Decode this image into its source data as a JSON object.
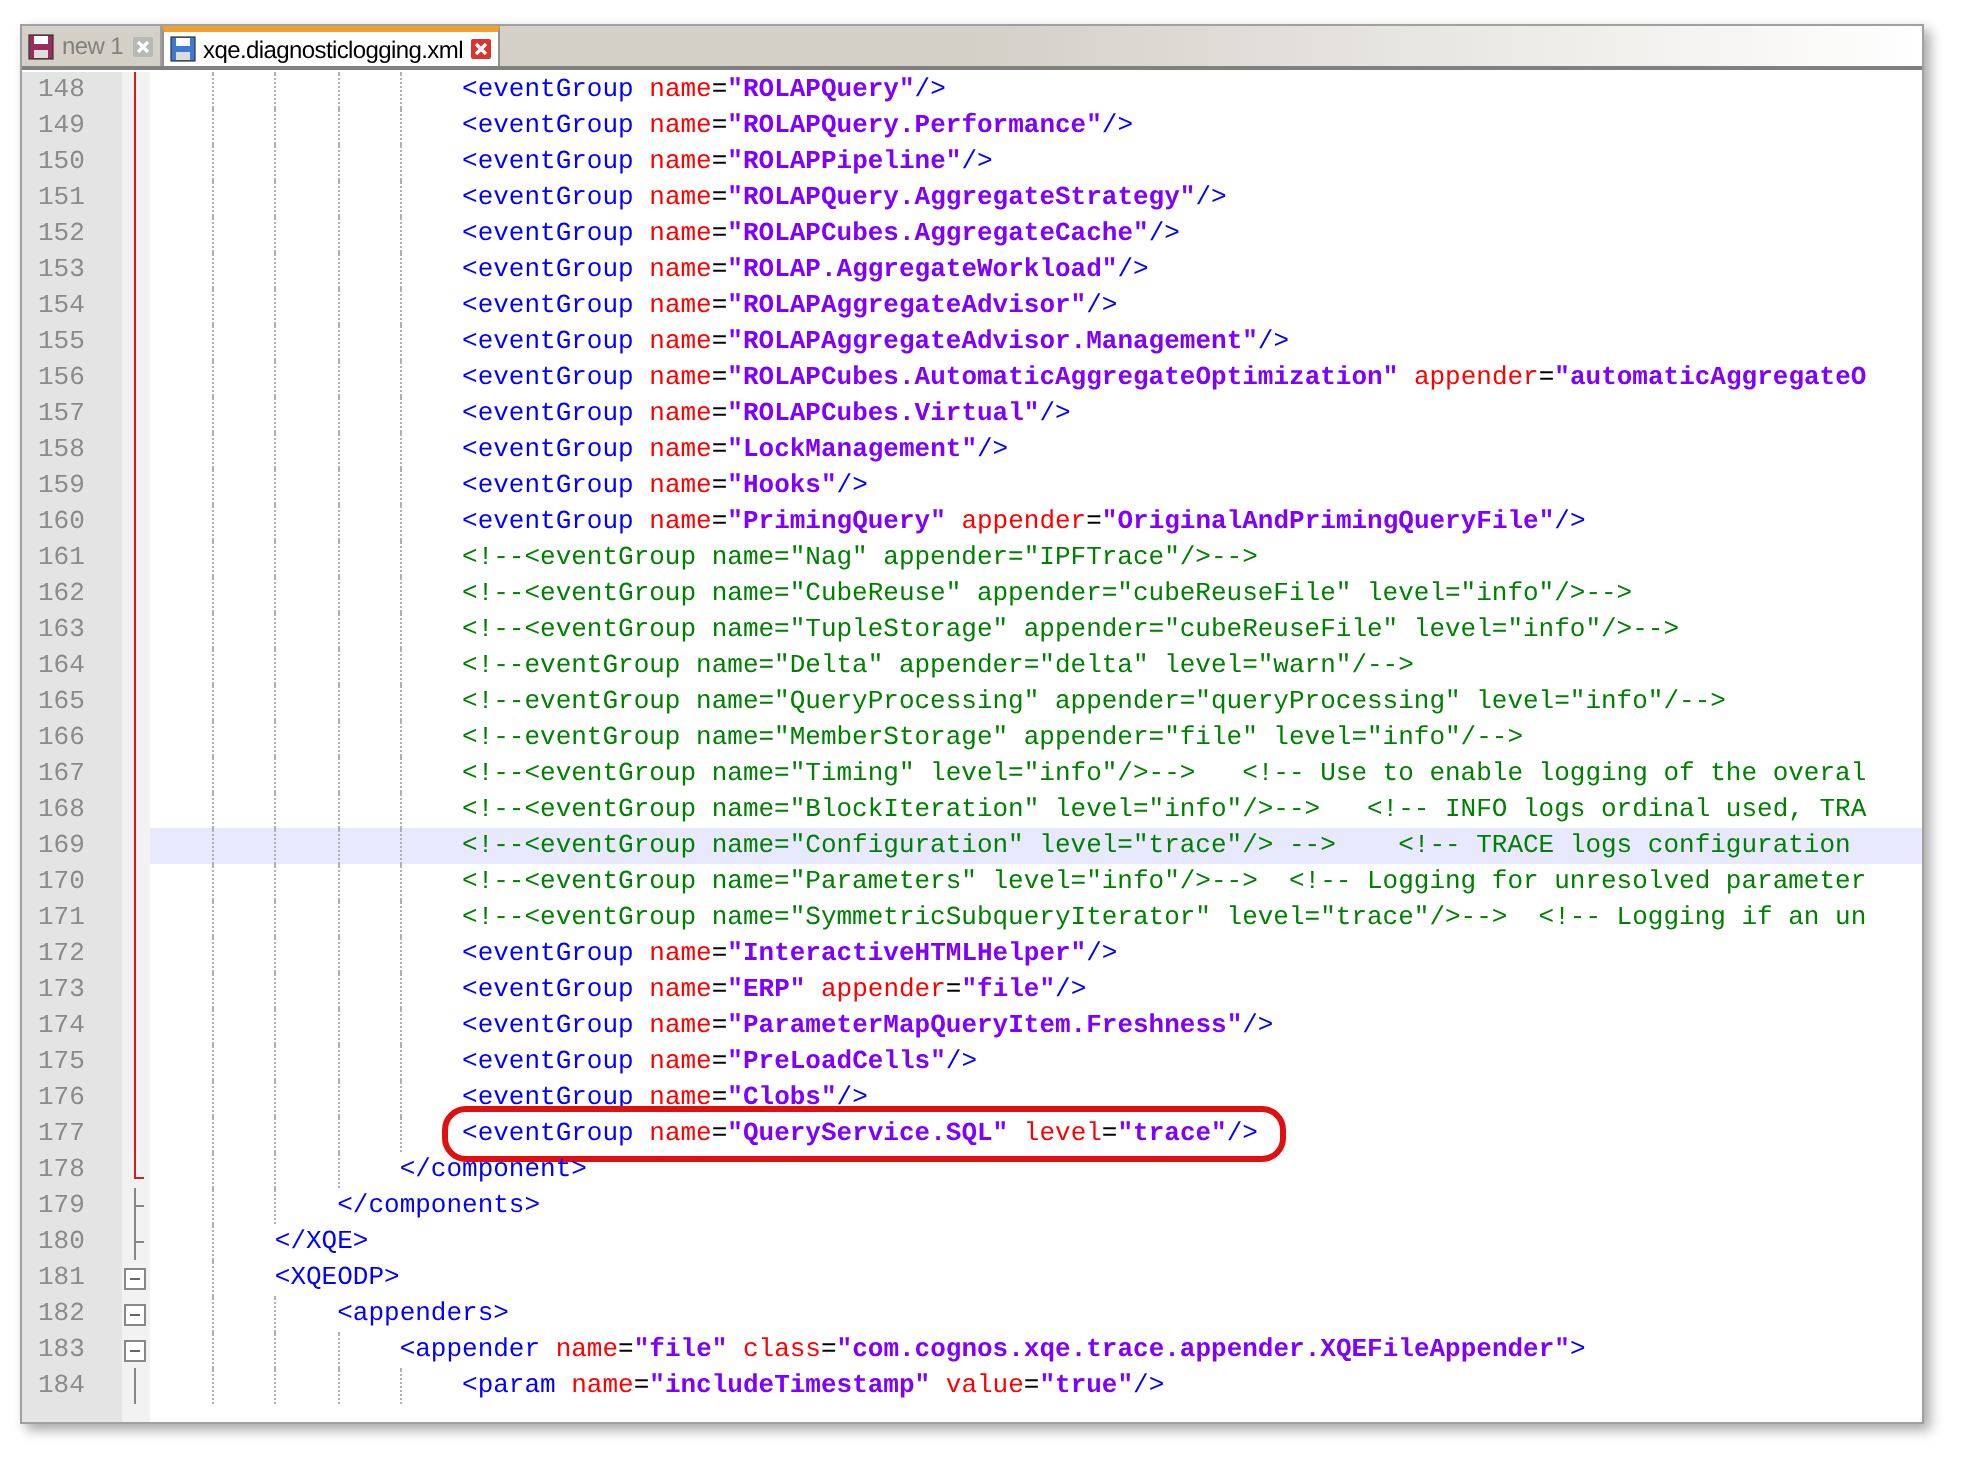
{
  "tabs": [
    {
      "label": "new 1",
      "selected": false,
      "modified": true
    },
    {
      "label": "xqe.diagnosticlogging.xml",
      "selected": true,
      "modified": false
    }
  ],
  "lines": [
    {
      "number": "148",
      "kind": "red",
      "current": false,
      "circled": false,
      "segments": [
        {
          "kind": "tag",
          "text": "                    <eventGroup"
        },
        {
          "kind": "attr",
          "text": " name"
        },
        {
          "kind": "eq",
          "text": "="
        },
        {
          "kind": "value",
          "text": "\"ROLAPQuery\""
        },
        {
          "kind": "tag",
          "text": "/>"
        }
      ]
    },
    {
      "number": "149",
      "kind": "red",
      "current": false,
      "circled": false,
      "segments": [
        {
          "kind": "tag",
          "text": "                    <eventGroup"
        },
        {
          "kind": "attr",
          "text": " name"
        },
        {
          "kind": "eq",
          "text": "="
        },
        {
          "kind": "value",
          "text": "\"ROLAPQuery.Performance\""
        },
        {
          "kind": "tag",
          "text": "/>"
        }
      ]
    },
    {
      "number": "150",
      "kind": "red",
      "current": false,
      "circled": false,
      "segments": [
        {
          "kind": "tag",
          "text": "                    <eventGroup"
        },
        {
          "kind": "attr",
          "text": " name"
        },
        {
          "kind": "eq",
          "text": "="
        },
        {
          "kind": "value",
          "text": "\"ROLAPPipeline\""
        },
        {
          "kind": "tag",
          "text": "/>"
        }
      ]
    },
    {
      "number": "151",
      "kind": "red",
      "current": false,
      "circled": false,
      "segments": [
        {
          "kind": "tag",
          "text": "                    <eventGroup"
        },
        {
          "kind": "attr",
          "text": " name"
        },
        {
          "kind": "eq",
          "text": "="
        },
        {
          "kind": "value",
          "text": "\"ROLAPQuery.AggregateStrategy\""
        },
        {
          "kind": "tag",
          "text": "/>"
        }
      ]
    },
    {
      "number": "152",
      "kind": "red",
      "current": false,
      "circled": false,
      "segments": [
        {
          "kind": "tag",
          "text": "                    <eventGroup"
        },
        {
          "kind": "attr",
          "text": " name"
        },
        {
          "kind": "eq",
          "text": "="
        },
        {
          "kind": "value",
          "text": "\"ROLAPCubes.AggregateCache\""
        },
        {
          "kind": "tag",
          "text": "/>"
        }
      ]
    },
    {
      "number": "153",
      "kind": "red",
      "current": false,
      "circled": false,
      "segments": [
        {
          "kind": "tag",
          "text": "                    <eventGroup"
        },
        {
          "kind": "attr",
          "text": " name"
        },
        {
          "kind": "eq",
          "text": "="
        },
        {
          "kind": "value",
          "text": "\"ROLAP.AggregateWorkload\""
        },
        {
          "kind": "tag",
          "text": "/>"
        }
      ]
    },
    {
      "number": "154",
      "kind": "red",
      "current": false,
      "circled": false,
      "segments": [
        {
          "kind": "tag",
          "text": "                    <eventGroup"
        },
        {
          "kind": "attr",
          "text": " name"
        },
        {
          "kind": "eq",
          "text": "="
        },
        {
          "kind": "value",
          "text": "\"ROLAPAggregateAdvisor\""
        },
        {
          "kind": "tag",
          "text": "/>"
        }
      ]
    },
    {
      "number": "155",
      "kind": "red",
      "current": false,
      "circled": false,
      "segments": [
        {
          "kind": "tag",
          "text": "                    <eventGroup"
        },
        {
          "kind": "attr",
          "text": " name"
        },
        {
          "kind": "eq",
          "text": "="
        },
        {
          "kind": "value",
          "text": "\"ROLAPAggregateAdvisor.Management\""
        },
        {
          "kind": "tag",
          "text": "/>"
        }
      ]
    },
    {
      "number": "156",
      "kind": "red",
      "current": false,
      "circled": false,
      "segments": [
        {
          "kind": "tag",
          "text": "                    <eventGroup"
        },
        {
          "kind": "attr",
          "text": " name"
        },
        {
          "kind": "eq",
          "text": "="
        },
        {
          "kind": "value",
          "text": "\"ROLAPCubes.AutomaticAggregateOptimization\""
        },
        {
          "kind": "attr",
          "text": " appender"
        },
        {
          "kind": "eq",
          "text": "="
        },
        {
          "kind": "value",
          "text": "\"automaticAggregateO"
        }
      ]
    },
    {
      "number": "157",
      "kind": "red",
      "current": false,
      "circled": false,
      "segments": [
        {
          "kind": "tag",
          "text": "                    <eventGroup"
        },
        {
          "kind": "attr",
          "text": " name"
        },
        {
          "kind": "eq",
          "text": "="
        },
        {
          "kind": "value",
          "text": "\"ROLAPCubes.Virtual\""
        },
        {
          "kind": "tag",
          "text": "/>"
        }
      ]
    },
    {
      "number": "158",
      "kind": "red",
      "current": false,
      "circled": false,
      "segments": [
        {
          "kind": "tag",
          "text": "                    <eventGroup"
        },
        {
          "kind": "attr",
          "text": " name"
        },
        {
          "kind": "eq",
          "text": "="
        },
        {
          "kind": "value",
          "text": "\"LockManagement\""
        },
        {
          "kind": "tag",
          "text": "/>"
        }
      ]
    },
    {
      "number": "159",
      "kind": "red",
      "current": false,
      "circled": false,
      "segments": [
        {
          "kind": "tag",
          "text": "                    <eventGroup"
        },
        {
          "kind": "attr",
          "text": " name"
        },
        {
          "kind": "eq",
          "text": "="
        },
        {
          "kind": "value",
          "text": "\"Hooks\""
        },
        {
          "kind": "tag",
          "text": "/>"
        }
      ]
    },
    {
      "number": "160",
      "kind": "red",
      "current": false,
      "circled": false,
      "segments": [
        {
          "kind": "tag",
          "text": "                    <eventGroup"
        },
        {
          "kind": "attr",
          "text": " name"
        },
        {
          "kind": "eq",
          "text": "="
        },
        {
          "kind": "value",
          "text": "\"PrimingQuery\""
        },
        {
          "kind": "attr",
          "text": " appender"
        },
        {
          "kind": "eq",
          "text": "="
        },
        {
          "kind": "value",
          "text": "\"OriginalAndPrimingQueryFile\""
        },
        {
          "kind": "tag",
          "text": "/>"
        }
      ]
    },
    {
      "number": "161",
      "kind": "red",
      "current": false,
      "circled": false,
      "segments": [
        {
          "kind": "comment",
          "text": "                    <!--<eventGroup name=\"Nag\" appender=\"IPFTrace\"/>-->"
        }
      ]
    },
    {
      "number": "162",
      "kind": "red",
      "current": false,
      "circled": false,
      "segments": [
        {
          "kind": "comment",
          "text": "                    <!--<eventGroup name=\"CubeReuse\" appender=\"cubeReuseFile\" level=\"info\"/>-->"
        }
      ]
    },
    {
      "number": "163",
      "kind": "red",
      "current": false,
      "circled": false,
      "segments": [
        {
          "kind": "comment",
          "text": "                    <!--<eventGroup name=\"TupleStorage\" appender=\"cubeReuseFile\" level=\"info\"/>-->"
        }
      ]
    },
    {
      "number": "164",
      "kind": "red",
      "current": false,
      "circled": false,
      "segments": [
        {
          "kind": "comment",
          "text": "                    <!--eventGroup name=\"Delta\" appender=\"delta\" level=\"warn\"/-->"
        }
      ]
    },
    {
      "number": "165",
      "kind": "red",
      "current": false,
      "circled": false,
      "segments": [
        {
          "kind": "comment",
          "text": "                    <!--eventGroup name=\"QueryProcessing\" appender=\"queryProcessing\" level=\"info\"/-->"
        }
      ]
    },
    {
      "number": "166",
      "kind": "red",
      "current": false,
      "circled": false,
      "segments": [
        {
          "kind": "comment",
          "text": "                    <!--eventGroup name=\"MemberStorage\" appender=\"file\" level=\"info\"/-->"
        }
      ]
    },
    {
      "number": "167",
      "kind": "red",
      "current": false,
      "circled": false,
      "segments": [
        {
          "kind": "comment",
          "text": "                    <!--<eventGroup name=\"Timing\" level=\"info\"/>-->   <!-- Use to enable logging of the overal"
        }
      ]
    },
    {
      "number": "168",
      "kind": "red",
      "current": false,
      "circled": false,
      "segments": [
        {
          "kind": "comment",
          "text": "                    <!--<eventGroup name=\"BlockIteration\" level=\"info\"/>-->   <!-- INFO logs ordinal used, TRA"
        }
      ]
    },
    {
      "number": "169",
      "kind": "red",
      "current": true,
      "circled": false,
      "segments": [
        {
          "kind": "comment",
          "text": "                    <!--<eventGroup name=\"Configuration\" level=\"trace\"/> -->    <!-- TRACE logs configuration"
        }
      ]
    },
    {
      "number": "170",
      "kind": "red",
      "current": false,
      "circled": false,
      "segments": [
        {
          "kind": "comment",
          "text": "                    <!--<eventGroup name=\"Parameters\" level=\"info\"/>-->  <!-- Logging for unresolved parameter"
        }
      ]
    },
    {
      "number": "171",
      "kind": "red",
      "current": false,
      "circled": false,
      "segments": [
        {
          "kind": "comment",
          "text": "                    <!--<eventGroup name=\"SymmetricSubqueryIterator\" level=\"trace\"/>-->  <!-- Logging if an un"
        }
      ]
    },
    {
      "number": "172",
      "kind": "red",
      "current": false,
      "circled": false,
      "segments": [
        {
          "kind": "tag",
          "text": "                    <eventGroup"
        },
        {
          "kind": "attr",
          "text": " name"
        },
        {
          "kind": "eq",
          "text": "="
        },
        {
          "kind": "value",
          "text": "\"InteractiveHTMLHelper\""
        },
        {
          "kind": "tag",
          "text": "/>"
        }
      ]
    },
    {
      "number": "173",
      "kind": "red",
      "current": false,
      "circled": false,
      "segments": [
        {
          "kind": "tag",
          "text": "                    <eventGroup"
        },
        {
          "kind": "attr",
          "text": " name"
        },
        {
          "kind": "eq",
          "text": "="
        },
        {
          "kind": "value",
          "text": "\"ERP\""
        },
        {
          "kind": "attr",
          "text": " appender"
        },
        {
          "kind": "eq",
          "text": "="
        },
        {
          "kind": "value",
          "text": "\"file\""
        },
        {
          "kind": "tag",
          "text": "/>"
        }
      ]
    },
    {
      "number": "174",
      "kind": "red",
      "current": false,
      "circled": false,
      "segments": [
        {
          "kind": "tag",
          "text": "                    <eventGroup"
        },
        {
          "kind": "attr",
          "text": " name"
        },
        {
          "kind": "eq",
          "text": "="
        },
        {
          "kind": "value",
          "text": "\"ParameterMapQueryItem.Freshness\""
        },
        {
          "kind": "tag",
          "text": "/>"
        }
      ]
    },
    {
      "number": "175",
      "kind": "red",
      "current": false,
      "circled": false,
      "segments": [
        {
          "kind": "tag",
          "text": "                    <eventGroup"
        },
        {
          "kind": "attr",
          "text": " name"
        },
        {
          "kind": "eq",
          "text": "="
        },
        {
          "kind": "value",
          "text": "\"PreLoadCells\""
        },
        {
          "kind": "tag",
          "text": "/>"
        }
      ]
    },
    {
      "number": "176",
      "kind": "red",
      "current": false,
      "circled": false,
      "segments": [
        {
          "kind": "tag",
          "text": "                    <eventGroup"
        },
        {
          "kind": "attr",
          "text": " name"
        },
        {
          "kind": "eq",
          "text": "="
        },
        {
          "kind": "value",
          "text": "\"Clobs\""
        },
        {
          "kind": "tag",
          "text": "/>"
        }
      ]
    },
    {
      "number": "177",
      "kind": "red",
      "current": false,
      "circled": true,
      "segments": [
        {
          "kind": "tag",
          "text": "                    <eventGroup"
        },
        {
          "kind": "attr",
          "text": " name"
        },
        {
          "kind": "eq",
          "text": "="
        },
        {
          "kind": "value",
          "text": "\"QueryService.SQL\""
        },
        {
          "kind": "attr",
          "text": " level"
        },
        {
          "kind": "eq",
          "text": "="
        },
        {
          "kind": "value",
          "text": "\"trace\""
        },
        {
          "kind": "tag",
          "text": "/>"
        }
      ]
    },
    {
      "number": "178",
      "kind": "red-end",
      "current": false,
      "circled": false,
      "segments": [
        {
          "kind": "tag",
          "text": "                </component>"
        }
      ]
    },
    {
      "number": "179",
      "kind": "end",
      "current": false,
      "circled": false,
      "segments": [
        {
          "kind": "tag",
          "text": "            </components>"
        }
      ]
    },
    {
      "number": "180",
      "kind": "end",
      "current": false,
      "circled": false,
      "segments": [
        {
          "kind": "tag",
          "text": "        </XQE>"
        }
      ]
    },
    {
      "number": "181",
      "kind": "open",
      "current": false,
      "circled": false,
      "segments": [
        {
          "kind": "tag",
          "text": "        <XQEODP>"
        }
      ]
    },
    {
      "number": "182",
      "kind": "open",
      "current": false,
      "circled": false,
      "segments": [
        {
          "kind": "tag",
          "text": "            <appenders>"
        }
      ]
    },
    {
      "number": "183",
      "kind": "open",
      "current": false,
      "circled": false,
      "segments": [
        {
          "kind": "tag",
          "text": "                <appender"
        },
        {
          "kind": "attr",
          "text": " name"
        },
        {
          "kind": "eq",
          "text": "="
        },
        {
          "kind": "value",
          "text": "\"file\""
        },
        {
          "kind": "attr",
          "text": " class"
        },
        {
          "kind": "eq",
          "text": "="
        },
        {
          "kind": "value",
          "text": "\"com.cognos.xqe.trace.appender.XQEFileAppender\""
        },
        {
          "kind": "tag",
          "text": ">"
        }
      ]
    },
    {
      "number": "184",
      "kind": "line",
      "current": false,
      "circled": false,
      "segments": [
        {
          "kind": "tag",
          "text": "                    <param"
        },
        {
          "kind": "attr",
          "text": " name"
        },
        {
          "kind": "eq",
          "text": "="
        },
        {
          "kind": "value",
          "text": "\"includeTimestamp\""
        },
        {
          "kind": "attr",
          "text": " value"
        },
        {
          "kind": "eq",
          "text": "="
        },
        {
          "kind": "value",
          "text": "\"true\""
        },
        {
          "kind": "tag",
          "text": "/>"
        }
      ]
    }
  ]
}
